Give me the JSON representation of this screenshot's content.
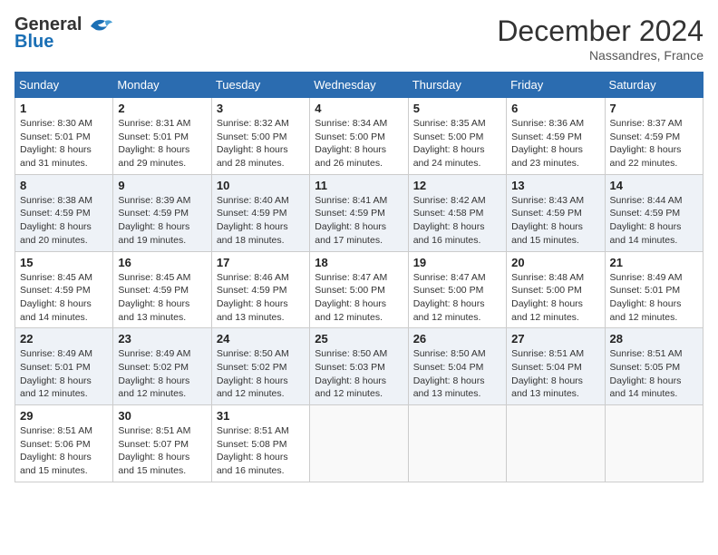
{
  "header": {
    "logo": {
      "text_general": "General",
      "text_blue": "Blue",
      "bird_unicode": "🐦"
    },
    "title": "December 2024",
    "location": "Nassandres, France"
  },
  "weekdays": [
    "Sunday",
    "Monday",
    "Tuesday",
    "Wednesday",
    "Thursday",
    "Friday",
    "Saturday"
  ],
  "weeks": [
    [
      {
        "day": "1",
        "sunrise": "8:30 AM",
        "sunset": "5:01 PM",
        "daylight": "8 hours and 31 minutes."
      },
      {
        "day": "2",
        "sunrise": "8:31 AM",
        "sunset": "5:01 PM",
        "daylight": "8 hours and 29 minutes."
      },
      {
        "day": "3",
        "sunrise": "8:32 AM",
        "sunset": "5:00 PM",
        "daylight": "8 hours and 28 minutes."
      },
      {
        "day": "4",
        "sunrise": "8:34 AM",
        "sunset": "5:00 PM",
        "daylight": "8 hours and 26 minutes."
      },
      {
        "day": "5",
        "sunrise": "8:35 AM",
        "sunset": "5:00 PM",
        "daylight": "8 hours and 24 minutes."
      },
      {
        "day": "6",
        "sunrise": "8:36 AM",
        "sunset": "4:59 PM",
        "daylight": "8 hours and 23 minutes."
      },
      {
        "day": "7",
        "sunrise": "8:37 AM",
        "sunset": "4:59 PM",
        "daylight": "8 hours and 22 minutes."
      }
    ],
    [
      {
        "day": "8",
        "sunrise": "8:38 AM",
        "sunset": "4:59 PM",
        "daylight": "8 hours and 20 minutes."
      },
      {
        "day": "9",
        "sunrise": "8:39 AM",
        "sunset": "4:59 PM",
        "daylight": "8 hours and 19 minutes."
      },
      {
        "day": "10",
        "sunrise": "8:40 AM",
        "sunset": "4:59 PM",
        "daylight": "8 hours and 18 minutes."
      },
      {
        "day": "11",
        "sunrise": "8:41 AM",
        "sunset": "4:59 PM",
        "daylight": "8 hours and 17 minutes."
      },
      {
        "day": "12",
        "sunrise": "8:42 AM",
        "sunset": "4:58 PM",
        "daylight": "8 hours and 16 minutes."
      },
      {
        "day": "13",
        "sunrise": "8:43 AM",
        "sunset": "4:59 PM",
        "daylight": "8 hours and 15 minutes."
      },
      {
        "day": "14",
        "sunrise": "8:44 AM",
        "sunset": "4:59 PM",
        "daylight": "8 hours and 14 minutes."
      }
    ],
    [
      {
        "day": "15",
        "sunrise": "8:45 AM",
        "sunset": "4:59 PM",
        "daylight": "8 hours and 14 minutes."
      },
      {
        "day": "16",
        "sunrise": "8:45 AM",
        "sunset": "4:59 PM",
        "daylight": "8 hours and 13 minutes."
      },
      {
        "day": "17",
        "sunrise": "8:46 AM",
        "sunset": "4:59 PM",
        "daylight": "8 hours and 13 minutes."
      },
      {
        "day": "18",
        "sunrise": "8:47 AM",
        "sunset": "5:00 PM",
        "daylight": "8 hours and 12 minutes."
      },
      {
        "day": "19",
        "sunrise": "8:47 AM",
        "sunset": "5:00 PM",
        "daylight": "8 hours and 12 minutes."
      },
      {
        "day": "20",
        "sunrise": "8:48 AM",
        "sunset": "5:00 PM",
        "daylight": "8 hours and 12 minutes."
      },
      {
        "day": "21",
        "sunrise": "8:49 AM",
        "sunset": "5:01 PM",
        "daylight": "8 hours and 12 minutes."
      }
    ],
    [
      {
        "day": "22",
        "sunrise": "8:49 AM",
        "sunset": "5:01 PM",
        "daylight": "8 hours and 12 minutes."
      },
      {
        "day": "23",
        "sunrise": "8:49 AM",
        "sunset": "5:02 PM",
        "daylight": "8 hours and 12 minutes."
      },
      {
        "day": "24",
        "sunrise": "8:50 AM",
        "sunset": "5:02 PM",
        "daylight": "8 hours and 12 minutes."
      },
      {
        "day": "25",
        "sunrise": "8:50 AM",
        "sunset": "5:03 PM",
        "daylight": "8 hours and 12 minutes."
      },
      {
        "day": "26",
        "sunrise": "8:50 AM",
        "sunset": "5:04 PM",
        "daylight": "8 hours and 13 minutes."
      },
      {
        "day": "27",
        "sunrise": "8:51 AM",
        "sunset": "5:04 PM",
        "daylight": "8 hours and 13 minutes."
      },
      {
        "day": "28",
        "sunrise": "8:51 AM",
        "sunset": "5:05 PM",
        "daylight": "8 hours and 14 minutes."
      }
    ],
    [
      {
        "day": "29",
        "sunrise": "8:51 AM",
        "sunset": "5:06 PM",
        "daylight": "8 hours and 15 minutes."
      },
      {
        "day": "30",
        "sunrise": "8:51 AM",
        "sunset": "5:07 PM",
        "daylight": "8 hours and 15 minutes."
      },
      {
        "day": "31",
        "sunrise": "8:51 AM",
        "sunset": "5:08 PM",
        "daylight": "8 hours and 16 minutes."
      },
      null,
      null,
      null,
      null
    ]
  ],
  "labels": {
    "sunrise": "Sunrise:",
    "sunset": "Sunset:",
    "daylight": "Daylight:"
  }
}
